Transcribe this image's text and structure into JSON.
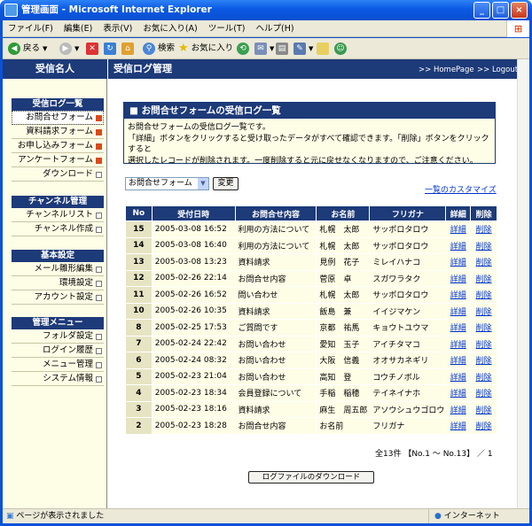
{
  "window": {
    "title": "管理画面 - Microsoft Internet Explorer"
  },
  "menu": [
    "ファイル(F)",
    "編集(E)",
    "表示(V)",
    "お気に入り(A)",
    "ツール(T)",
    "ヘルプ(H)"
  ],
  "toolbar": {
    "back": "戻る",
    "search": "検索",
    "favorites": "お気に入り"
  },
  "sidebar": {
    "header": "受信名人",
    "sections": [
      {
        "title": "受信ログ一覧",
        "items": [
          "お問合せフォーム",
          "資料請求フォーム",
          "お申し込みフォーム",
          "アンケートフォーム",
          "ダウンロード"
        ]
      },
      {
        "title": "チャンネル管理",
        "items": [
          "チャンネルリスト",
          "チャンネル作成"
        ]
      },
      {
        "title": "基本設定",
        "items": [
          "メール雛形編集",
          "環境設定",
          "アカウント設定"
        ]
      },
      {
        "title": "管理メニュー",
        "items": [
          "フォルダ設定",
          "ログイン履歴",
          "メニュー管理",
          "システム情報"
        ]
      }
    ]
  },
  "header": {
    "title": "受信ログ管理",
    "home": ">> HomePage",
    "logout": ">> Logout"
  },
  "info": {
    "title": "お問合せフォームの受信ログ一覧",
    "line1": "お問合せフォームの受信ログ一覧です。",
    "line2": "「詳細」ボタンをクリックすると受け取ったデータがすべて確認できます。「削除」ボタンをクリックすると",
    "line3": "選択したレコードが削除されます。一度削除すると元に戻せなくなりますので、ご注意ください。"
  },
  "filter": {
    "selected": "お問合せフォーム",
    "button": "変更",
    "customize": "一覧のカスタマイズ"
  },
  "table": {
    "headers": [
      "No",
      "受付日時",
      "お問合せ内容",
      "お名前",
      "フリガナ",
      "詳細",
      "削除"
    ],
    "rows": [
      [
        "15",
        "2005-03-08 16:52",
        "利用の方法について",
        "札幌　太郎",
        "サッポロタロウ",
        "詳細",
        "削除"
      ],
      [
        "14",
        "2005-03-08 16:40",
        "利用の方法について",
        "札幌　太郎",
        "サッポロタロウ",
        "詳細",
        "削除"
      ],
      [
        "13",
        "2005-03-08 13:23",
        "資料請求",
        "見例　花子",
        "ミレイハナコ",
        "詳細",
        "削除"
      ],
      [
        "12",
        "2005-02-26 22:14",
        "お問合せ内容",
        "菅原　卓",
        "スガワラタク",
        "詳細",
        "削除"
      ],
      [
        "11",
        "2005-02-26 16:52",
        "問い合わせ",
        "札幌　太郎",
        "サッポロタロウ",
        "詳細",
        "削除"
      ],
      [
        "10",
        "2005-02-26 10:35",
        "資料請求",
        "飯島　兼",
        "イイジマケン",
        "詳細",
        "削除"
      ],
      [
        "8",
        "2005-02-25 17:53",
        "ご質問です",
        "京都　祐馬",
        "キョウトユウマ",
        "詳細",
        "削除"
      ],
      [
        "7",
        "2005-02-24 22:42",
        "お問い合わせ",
        "愛知　玉子",
        "アイチタマコ",
        "詳細",
        "削除"
      ],
      [
        "6",
        "2005-02-24 08:32",
        "お問い合わせ",
        "大阪　信義",
        "オオサカネギリ",
        "詳細",
        "削除"
      ],
      [
        "5",
        "2005-02-23 21:04",
        "お問い合わせ",
        "高知　登",
        "コウチノボル",
        "詳細",
        "削除"
      ],
      [
        "4",
        "2005-02-23 18:34",
        "会員登録について",
        "手稲　稲穂",
        "テイネイナホ",
        "詳細",
        "削除"
      ],
      [
        "3",
        "2005-02-23 18:16",
        "資料請求",
        "麻生　周五郎",
        "アソウシュウゴロウ",
        "詳細",
        "削除"
      ],
      [
        "2",
        "2005-02-23 18:28",
        "お問合せ内容",
        "お名前",
        "フリガナ",
        "詳細",
        "削除"
      ]
    ]
  },
  "summary": "全13件 【No.1 〜 No.13】 ／ 1",
  "download": "ログファイルのダウンロード",
  "status": {
    "left": "ページが表示されました",
    "zone": "インターネット"
  },
  "icons": {
    "title": "ie-icon",
    "back": "back-arrow-icon",
    "forward": "forward-arrow-icon",
    "stop": "stop-icon",
    "refresh": "refresh-icon",
    "home": "home-icon",
    "search": "search-icon",
    "favorites": "star-icon",
    "history": "history-icon"
  }
}
